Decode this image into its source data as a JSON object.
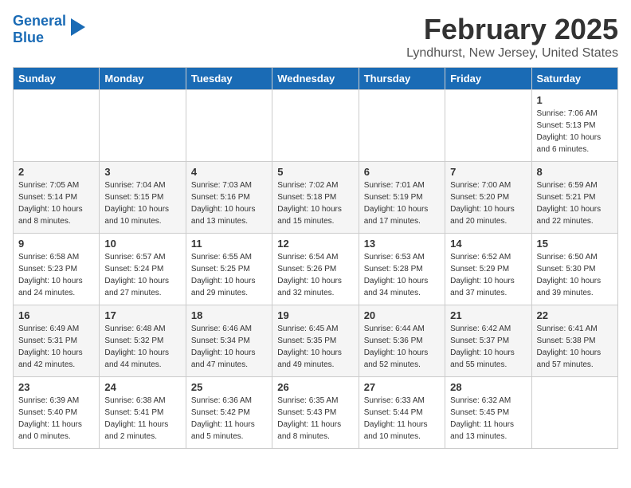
{
  "header": {
    "logo_line1": "General",
    "logo_line2": "Blue",
    "month": "February 2025",
    "location": "Lyndhurst, New Jersey, United States"
  },
  "days_of_week": [
    "Sunday",
    "Monday",
    "Tuesday",
    "Wednesday",
    "Thursday",
    "Friday",
    "Saturday"
  ],
  "weeks": [
    [
      {
        "day": "",
        "info": ""
      },
      {
        "day": "",
        "info": ""
      },
      {
        "day": "",
        "info": ""
      },
      {
        "day": "",
        "info": ""
      },
      {
        "day": "",
        "info": ""
      },
      {
        "day": "",
        "info": ""
      },
      {
        "day": "1",
        "info": "Sunrise: 7:06 AM\nSunset: 5:13 PM\nDaylight: 10 hours\nand 6 minutes."
      }
    ],
    [
      {
        "day": "2",
        "info": "Sunrise: 7:05 AM\nSunset: 5:14 PM\nDaylight: 10 hours\nand 8 minutes."
      },
      {
        "day": "3",
        "info": "Sunrise: 7:04 AM\nSunset: 5:15 PM\nDaylight: 10 hours\nand 10 minutes."
      },
      {
        "day": "4",
        "info": "Sunrise: 7:03 AM\nSunset: 5:16 PM\nDaylight: 10 hours\nand 13 minutes."
      },
      {
        "day": "5",
        "info": "Sunrise: 7:02 AM\nSunset: 5:18 PM\nDaylight: 10 hours\nand 15 minutes."
      },
      {
        "day": "6",
        "info": "Sunrise: 7:01 AM\nSunset: 5:19 PM\nDaylight: 10 hours\nand 17 minutes."
      },
      {
        "day": "7",
        "info": "Sunrise: 7:00 AM\nSunset: 5:20 PM\nDaylight: 10 hours\nand 20 minutes."
      },
      {
        "day": "8",
        "info": "Sunrise: 6:59 AM\nSunset: 5:21 PM\nDaylight: 10 hours\nand 22 minutes."
      }
    ],
    [
      {
        "day": "9",
        "info": "Sunrise: 6:58 AM\nSunset: 5:23 PM\nDaylight: 10 hours\nand 24 minutes."
      },
      {
        "day": "10",
        "info": "Sunrise: 6:57 AM\nSunset: 5:24 PM\nDaylight: 10 hours\nand 27 minutes."
      },
      {
        "day": "11",
        "info": "Sunrise: 6:55 AM\nSunset: 5:25 PM\nDaylight: 10 hours\nand 29 minutes."
      },
      {
        "day": "12",
        "info": "Sunrise: 6:54 AM\nSunset: 5:26 PM\nDaylight: 10 hours\nand 32 minutes."
      },
      {
        "day": "13",
        "info": "Sunrise: 6:53 AM\nSunset: 5:28 PM\nDaylight: 10 hours\nand 34 minutes."
      },
      {
        "day": "14",
        "info": "Sunrise: 6:52 AM\nSunset: 5:29 PM\nDaylight: 10 hours\nand 37 minutes."
      },
      {
        "day": "15",
        "info": "Sunrise: 6:50 AM\nSunset: 5:30 PM\nDaylight: 10 hours\nand 39 minutes."
      }
    ],
    [
      {
        "day": "16",
        "info": "Sunrise: 6:49 AM\nSunset: 5:31 PM\nDaylight: 10 hours\nand 42 minutes."
      },
      {
        "day": "17",
        "info": "Sunrise: 6:48 AM\nSunset: 5:32 PM\nDaylight: 10 hours\nand 44 minutes."
      },
      {
        "day": "18",
        "info": "Sunrise: 6:46 AM\nSunset: 5:34 PM\nDaylight: 10 hours\nand 47 minutes."
      },
      {
        "day": "19",
        "info": "Sunrise: 6:45 AM\nSunset: 5:35 PM\nDaylight: 10 hours\nand 49 minutes."
      },
      {
        "day": "20",
        "info": "Sunrise: 6:44 AM\nSunset: 5:36 PM\nDaylight: 10 hours\nand 52 minutes."
      },
      {
        "day": "21",
        "info": "Sunrise: 6:42 AM\nSunset: 5:37 PM\nDaylight: 10 hours\nand 55 minutes."
      },
      {
        "day": "22",
        "info": "Sunrise: 6:41 AM\nSunset: 5:38 PM\nDaylight: 10 hours\nand 57 minutes."
      }
    ],
    [
      {
        "day": "23",
        "info": "Sunrise: 6:39 AM\nSunset: 5:40 PM\nDaylight: 11 hours\nand 0 minutes."
      },
      {
        "day": "24",
        "info": "Sunrise: 6:38 AM\nSunset: 5:41 PM\nDaylight: 11 hours\nand 2 minutes."
      },
      {
        "day": "25",
        "info": "Sunrise: 6:36 AM\nSunset: 5:42 PM\nDaylight: 11 hours\nand 5 minutes."
      },
      {
        "day": "26",
        "info": "Sunrise: 6:35 AM\nSunset: 5:43 PM\nDaylight: 11 hours\nand 8 minutes."
      },
      {
        "day": "27",
        "info": "Sunrise: 6:33 AM\nSunset: 5:44 PM\nDaylight: 11 hours\nand 10 minutes."
      },
      {
        "day": "28",
        "info": "Sunrise: 6:32 AM\nSunset: 5:45 PM\nDaylight: 11 hours\nand 13 minutes."
      },
      {
        "day": "",
        "info": ""
      }
    ]
  ]
}
